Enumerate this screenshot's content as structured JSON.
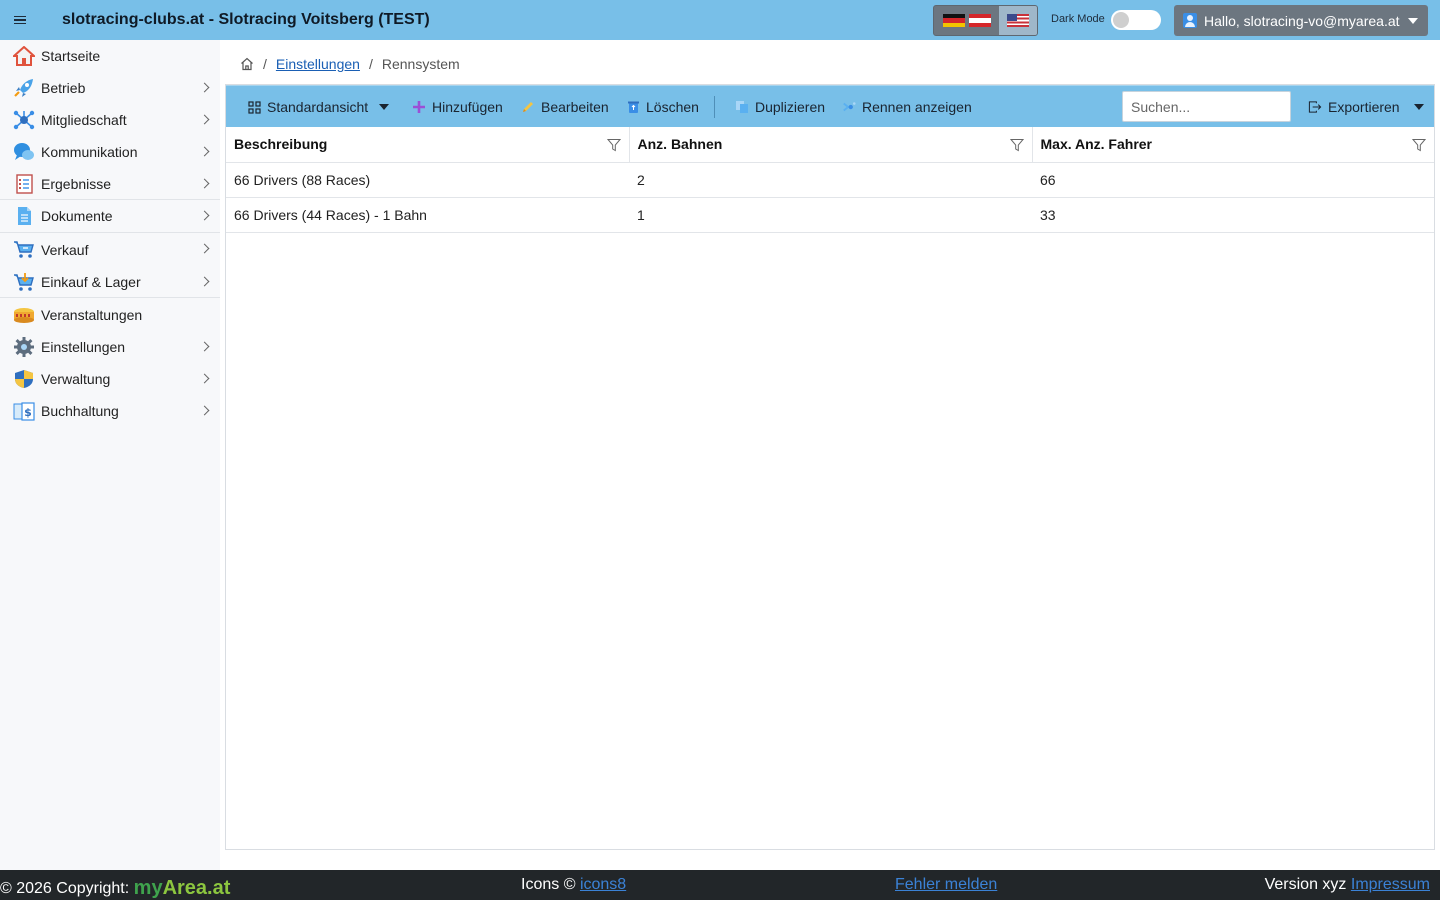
{
  "header": {
    "title": "slotracing-clubs.at - Slotracing Voitsberg (TEST)",
    "dark_mode_label": "Dark Mode",
    "user_label": "Hallo, slotracing-vo@myarea.at"
  },
  "sidebar": {
    "items": [
      {
        "label": "Startseite",
        "icon": "home-icon"
      },
      {
        "label": "Betrieb",
        "icon": "rocket-icon"
      },
      {
        "label": "Mitgliedschaft",
        "icon": "network-icon"
      },
      {
        "label": "Kommunikation",
        "icon": "chat-icon"
      },
      {
        "label": "Ergebnisse",
        "icon": "checklist-icon"
      },
      {
        "label": "Dokumente",
        "icon": "document-icon"
      },
      {
        "label": "Verkauf",
        "icon": "cart-icon"
      },
      {
        "label": "Einkauf & Lager",
        "icon": "cart-add-icon"
      },
      {
        "label": "Veranstaltungen",
        "icon": "stadium-icon"
      },
      {
        "label": "Einstellungen",
        "icon": "gear-icon"
      },
      {
        "label": "Verwaltung",
        "icon": "shield-icon"
      },
      {
        "label": "Buchhaltung",
        "icon": "invoice-icon"
      }
    ]
  },
  "breadcrumb": {
    "parent": "Einstellungen",
    "current": "Rennsystem"
  },
  "toolbar": {
    "view_label": "Standardansicht",
    "add_label": "Hinzufügen",
    "edit_label": "Bearbeiten",
    "delete_label": "Löschen",
    "duplicate_label": "Duplizieren",
    "show_races_label": "Rennen anzeigen",
    "search_placeholder": "Suchen...",
    "export_label": "Exportieren"
  },
  "table": {
    "columns": [
      "Beschreibung",
      "Anz. Bahnen",
      "Max. Anz. Fahrer"
    ],
    "rows": [
      [
        "66 Drivers (88 Races)",
        "2",
        "66"
      ],
      [
        "66 Drivers (44 Races) - 1 Bahn",
        "1",
        "33"
      ]
    ]
  },
  "footer": {
    "copyright": "© 2026 Copyright:",
    "brand_my": "my",
    "brand_area": "Area.at",
    "icons_label": "Icons ©",
    "icons_link": "icons8",
    "report_link": "Fehler melden",
    "version_label": "Version xyz",
    "impressum_link": "Impressum"
  },
  "colors": {
    "header_bg": "#78bfe8",
    "button_gray": "#6c7680",
    "footer_bg": "#222629",
    "link": "#1a5fb4"
  }
}
